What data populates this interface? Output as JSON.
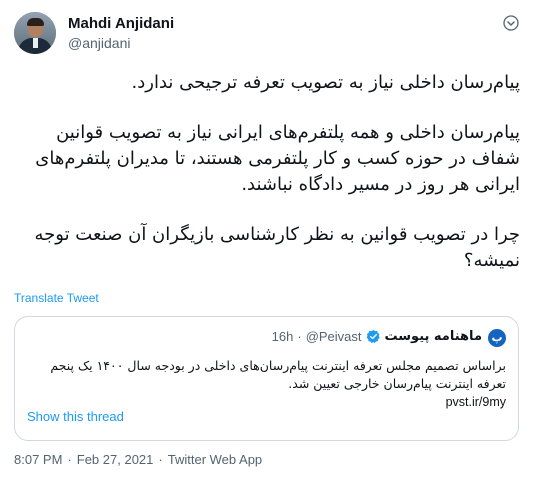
{
  "author": {
    "display_name": "Mahdi Anjidani",
    "handle": "@anjidani"
  },
  "tweet": {
    "paragraphs": [
      "پیام‌رسان داخلی نیاز به تصویب تعرفه ترجیحی ندارد.",
      "پیام‌رسان داخلی و همه پلتفرم‌های ایرانی نیاز به تصویب قوانین شفاف در حوزه کسب و کار پلتفرمی هستند، تا مدیران پلتفرم‌های ایرانی هر روز در مسیر دادگاه نباشند.",
      "چرا در تصویب قوانین به نظر کارشناسی بازیگران آن صنعت توجه نمیشه؟"
    ],
    "translate_label": "Translate Tweet"
  },
  "quote": {
    "avatar_glyph": "پ",
    "name": "ماهنامه پیوست",
    "handle": "@Peivast",
    "separator": "·",
    "time": "16h",
    "text": "براساس تصمیم مجلس تعرفه اینترنت پیام‌رسان‌های داخلی در بودجه سال ۱۴۰۰ یک پنجم تعرفه اینترنت پیام‌رسان خارجی تعیین شد.",
    "link": "pvst.ir/9my",
    "show_thread": "Show this thread"
  },
  "footer": {
    "time": "8:07 PM",
    "date": "Feb 27, 2021",
    "source": "Twitter Web App",
    "separator": "·"
  },
  "icons": {
    "more": "chevron-down-icon",
    "verified": "verified-badge-icon"
  },
  "colors": {
    "link": "#1d9bf0",
    "secondary_text": "#536471",
    "border": "#cfd9de",
    "verified": "#1d9bf0"
  }
}
